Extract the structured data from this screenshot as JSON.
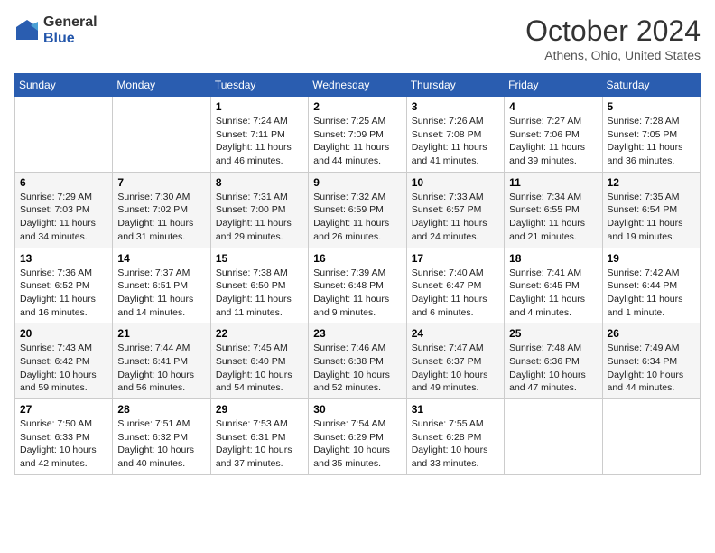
{
  "logo": {
    "general": "General",
    "blue": "Blue"
  },
  "header": {
    "month": "October 2024",
    "location": "Athens, Ohio, United States"
  },
  "weekdays": [
    "Sunday",
    "Monday",
    "Tuesday",
    "Wednesday",
    "Thursday",
    "Friday",
    "Saturday"
  ],
  "weeks": [
    [
      {
        "day": "",
        "info": ""
      },
      {
        "day": "",
        "info": ""
      },
      {
        "day": "1",
        "info": "Sunrise: 7:24 AM\nSunset: 7:11 PM\nDaylight: 11 hours and 46 minutes."
      },
      {
        "day": "2",
        "info": "Sunrise: 7:25 AM\nSunset: 7:09 PM\nDaylight: 11 hours and 44 minutes."
      },
      {
        "day": "3",
        "info": "Sunrise: 7:26 AM\nSunset: 7:08 PM\nDaylight: 11 hours and 41 minutes."
      },
      {
        "day": "4",
        "info": "Sunrise: 7:27 AM\nSunset: 7:06 PM\nDaylight: 11 hours and 39 minutes."
      },
      {
        "day": "5",
        "info": "Sunrise: 7:28 AM\nSunset: 7:05 PM\nDaylight: 11 hours and 36 minutes."
      }
    ],
    [
      {
        "day": "6",
        "info": "Sunrise: 7:29 AM\nSunset: 7:03 PM\nDaylight: 11 hours and 34 minutes."
      },
      {
        "day": "7",
        "info": "Sunrise: 7:30 AM\nSunset: 7:02 PM\nDaylight: 11 hours and 31 minutes."
      },
      {
        "day": "8",
        "info": "Sunrise: 7:31 AM\nSunset: 7:00 PM\nDaylight: 11 hours and 29 minutes."
      },
      {
        "day": "9",
        "info": "Sunrise: 7:32 AM\nSunset: 6:59 PM\nDaylight: 11 hours and 26 minutes."
      },
      {
        "day": "10",
        "info": "Sunrise: 7:33 AM\nSunset: 6:57 PM\nDaylight: 11 hours and 24 minutes."
      },
      {
        "day": "11",
        "info": "Sunrise: 7:34 AM\nSunset: 6:55 PM\nDaylight: 11 hours and 21 minutes."
      },
      {
        "day": "12",
        "info": "Sunrise: 7:35 AM\nSunset: 6:54 PM\nDaylight: 11 hours and 19 minutes."
      }
    ],
    [
      {
        "day": "13",
        "info": "Sunrise: 7:36 AM\nSunset: 6:52 PM\nDaylight: 11 hours and 16 minutes."
      },
      {
        "day": "14",
        "info": "Sunrise: 7:37 AM\nSunset: 6:51 PM\nDaylight: 11 hours and 14 minutes."
      },
      {
        "day": "15",
        "info": "Sunrise: 7:38 AM\nSunset: 6:50 PM\nDaylight: 11 hours and 11 minutes."
      },
      {
        "day": "16",
        "info": "Sunrise: 7:39 AM\nSunset: 6:48 PM\nDaylight: 11 hours and 9 minutes."
      },
      {
        "day": "17",
        "info": "Sunrise: 7:40 AM\nSunset: 6:47 PM\nDaylight: 11 hours and 6 minutes."
      },
      {
        "day": "18",
        "info": "Sunrise: 7:41 AM\nSunset: 6:45 PM\nDaylight: 11 hours and 4 minutes."
      },
      {
        "day": "19",
        "info": "Sunrise: 7:42 AM\nSunset: 6:44 PM\nDaylight: 11 hours and 1 minute."
      }
    ],
    [
      {
        "day": "20",
        "info": "Sunrise: 7:43 AM\nSunset: 6:42 PM\nDaylight: 10 hours and 59 minutes."
      },
      {
        "day": "21",
        "info": "Sunrise: 7:44 AM\nSunset: 6:41 PM\nDaylight: 10 hours and 56 minutes."
      },
      {
        "day": "22",
        "info": "Sunrise: 7:45 AM\nSunset: 6:40 PM\nDaylight: 10 hours and 54 minutes."
      },
      {
        "day": "23",
        "info": "Sunrise: 7:46 AM\nSunset: 6:38 PM\nDaylight: 10 hours and 52 minutes."
      },
      {
        "day": "24",
        "info": "Sunrise: 7:47 AM\nSunset: 6:37 PM\nDaylight: 10 hours and 49 minutes."
      },
      {
        "day": "25",
        "info": "Sunrise: 7:48 AM\nSunset: 6:36 PM\nDaylight: 10 hours and 47 minutes."
      },
      {
        "day": "26",
        "info": "Sunrise: 7:49 AM\nSunset: 6:34 PM\nDaylight: 10 hours and 44 minutes."
      }
    ],
    [
      {
        "day": "27",
        "info": "Sunrise: 7:50 AM\nSunset: 6:33 PM\nDaylight: 10 hours and 42 minutes."
      },
      {
        "day": "28",
        "info": "Sunrise: 7:51 AM\nSunset: 6:32 PM\nDaylight: 10 hours and 40 minutes."
      },
      {
        "day": "29",
        "info": "Sunrise: 7:53 AM\nSunset: 6:31 PM\nDaylight: 10 hours and 37 minutes."
      },
      {
        "day": "30",
        "info": "Sunrise: 7:54 AM\nSunset: 6:29 PM\nDaylight: 10 hours and 35 minutes."
      },
      {
        "day": "31",
        "info": "Sunrise: 7:55 AM\nSunset: 6:28 PM\nDaylight: 10 hours and 33 minutes."
      },
      {
        "day": "",
        "info": ""
      },
      {
        "day": "",
        "info": ""
      }
    ]
  ]
}
